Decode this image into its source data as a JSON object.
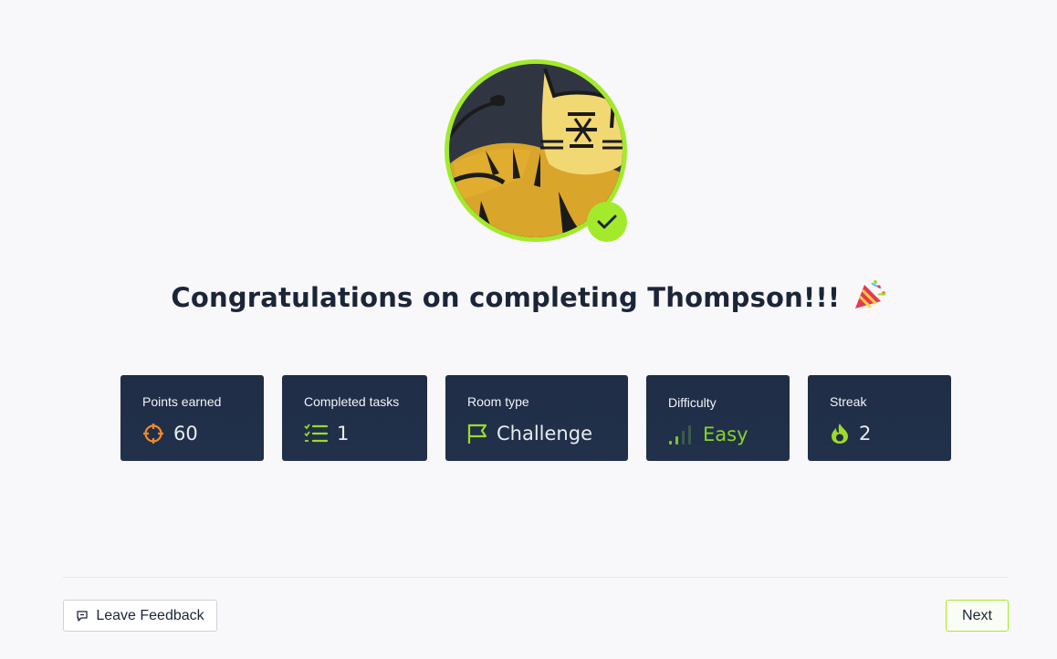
{
  "title": {
    "text": "Congratulations on completing Thompson!!!",
    "emoji": "party-popper-icon"
  },
  "avatar": {
    "name": "tomcat-room-avatar",
    "badge": "check-icon"
  },
  "stats": [
    {
      "label": "Points earned",
      "value": "60",
      "icon": "target-icon"
    },
    {
      "label": "Completed tasks",
      "value": "1",
      "icon": "task-list-icon"
    },
    {
      "label": "Room type",
      "value": "Challenge",
      "icon": "flag-icon"
    },
    {
      "label": "Difficulty",
      "value": "Easy",
      "icon": "signal-bars-icon"
    },
    {
      "label": "Streak",
      "value": "2",
      "icon": "flame-icon"
    }
  ],
  "footer": {
    "feedback_label": "Leave Feedback",
    "feedback_icon": "comment-icon",
    "next_label": "Next"
  },
  "colors": {
    "accent": "#a3ea2a",
    "card_bg": "#1f2d46",
    "points_orange": "#f48a2b",
    "green": "#86d42a",
    "text_dark": "#1c2538"
  }
}
